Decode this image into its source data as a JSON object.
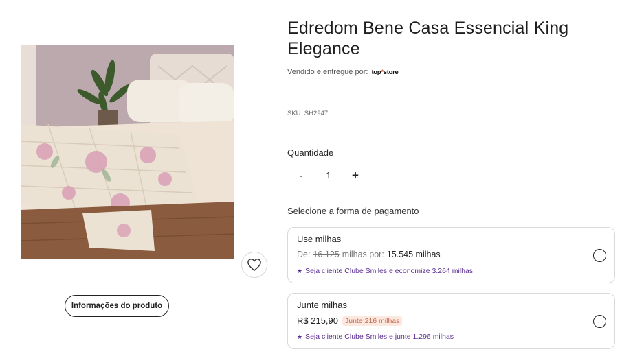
{
  "product": {
    "title": "Edredom Bene Casa Essencial King Elegance",
    "seller_prefix": "Vendido e entregue por:",
    "seller_logo_main": "top",
    "seller_logo_accent": "*",
    "seller_logo_suffix": "store",
    "sku": "SKU: SH2947",
    "info_button_label": "Informações do produto"
  },
  "quantity": {
    "label": "Quantidade",
    "minus": "-",
    "value": "1",
    "plus": "+"
  },
  "payment": {
    "label": "Selecione a forma de pagamento",
    "options": [
      {
        "title": "Use milhas",
        "price_prefix": "De:",
        "old_price": "16.125",
        "price_middle": "milhas por:",
        "new_price": "15.545 milhas",
        "promo": "Seja cliente Clube Smiles e economize 3.264 milhas"
      },
      {
        "title": "Junte milhas",
        "price": "R$ 215,90",
        "badge": "Junte 216 milhas",
        "promo": "Seja cliente Clube Smiles e junte 1.296 milhas"
      }
    ]
  },
  "colors": {
    "promo_purple": "#5b2d91",
    "badge_bg": "#fde8e0",
    "badge_text": "#c26a52"
  },
  "icons": {
    "favorite": "heart-icon",
    "promo": "star-icon"
  }
}
